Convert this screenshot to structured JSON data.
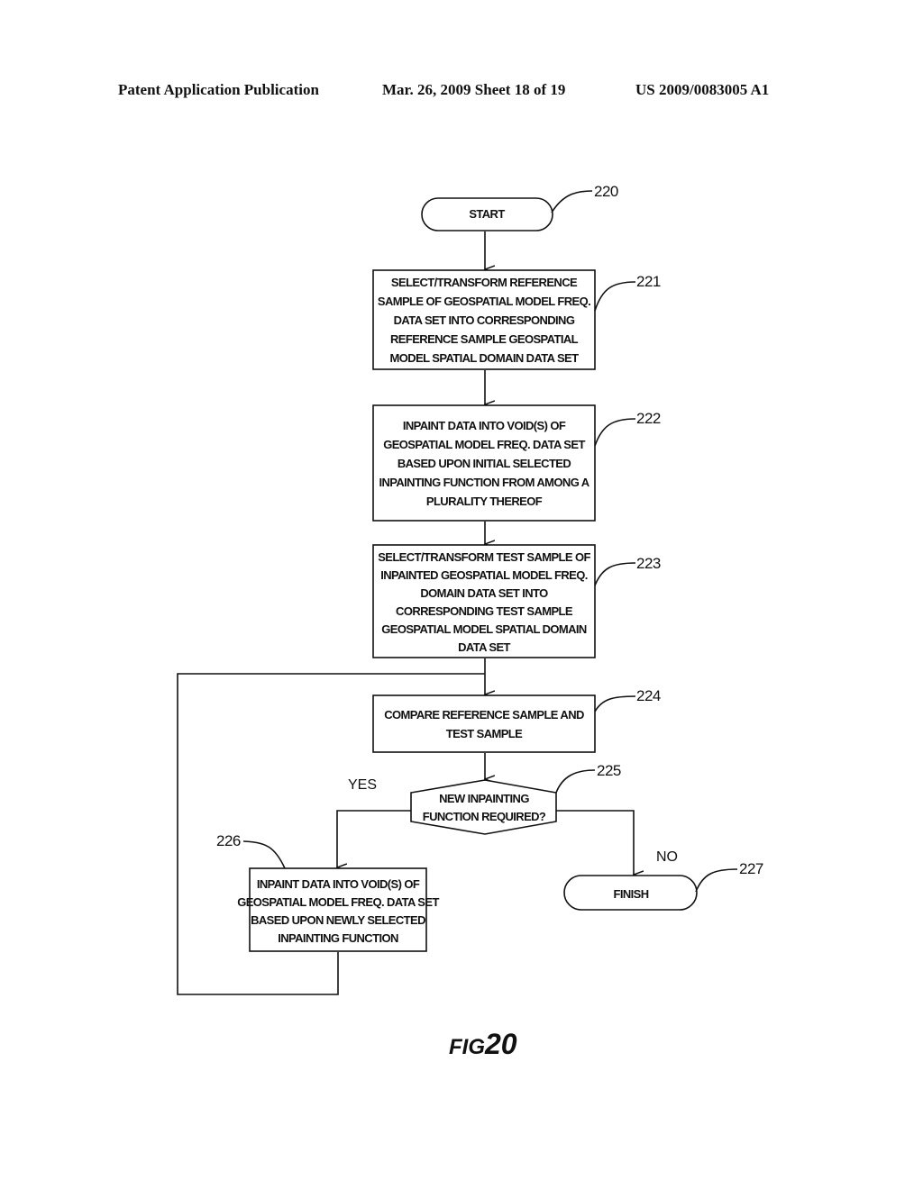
{
  "header": {
    "publication": "Patent Application Publication",
    "date_sheet": "Mar. 26, 2009  Sheet 18 of 19",
    "number": "US 2009/0083005 A1"
  },
  "flowchart": {
    "nodes": [
      {
        "id": "220",
        "type": "terminal",
        "lines": [
          "START"
        ]
      },
      {
        "id": "221",
        "type": "process",
        "lines": [
          "SELECT/TRANSFORM REFERENCE",
          "SAMPLE OF GEOSPATIAL MODEL FREQ.",
          "DATA SET INTO CORRESPONDING",
          "REFERENCE SAMPLE GEOSPATIAL",
          "MODEL SPATIAL DOMAIN DATA SET"
        ]
      },
      {
        "id": "222",
        "type": "process",
        "lines": [
          "INPAINT DATA INTO VOID(S) OF",
          "GEOSPATIAL MODEL FREQ. DATA SET",
          "BASED UPON INITIAL SELECTED",
          "INPAINTING FUNCTION FROM AMONG A",
          "PLURALITY THEREOF"
        ]
      },
      {
        "id": "223",
        "type": "process",
        "lines": [
          "SELECT/TRANSFORM TEST SAMPLE OF",
          "INPAINTED GEOSPATIAL MODEL FREQ.",
          "DOMAIN DATA SET INTO",
          "CORRESPONDING TEST SAMPLE",
          "GEOSPATIAL MODEL SPATIAL DOMAIN",
          "DATA SET"
        ]
      },
      {
        "id": "224",
        "type": "process",
        "lines": [
          "COMPARE REFERENCE SAMPLE AND",
          "TEST SAMPLE"
        ]
      },
      {
        "id": "225",
        "type": "decision",
        "lines": [
          "NEW INPAINTING",
          "FUNCTION REQUIRED?"
        ]
      },
      {
        "id": "226",
        "type": "process",
        "lines": [
          "INPAINT DATA INTO VOID(S) OF",
          "GEOSPATIAL MODEL FREQ. DATA SET",
          "BASED UPON NEWLY SELECTED",
          "INPAINTING FUNCTION"
        ]
      },
      {
        "id": "227",
        "type": "terminal",
        "lines": [
          "FINISH"
        ]
      }
    ],
    "edge_labels": {
      "yes": "YES",
      "no": "NO"
    },
    "figure_label": {
      "prefix": "FIG.",
      "number": "20"
    }
  }
}
